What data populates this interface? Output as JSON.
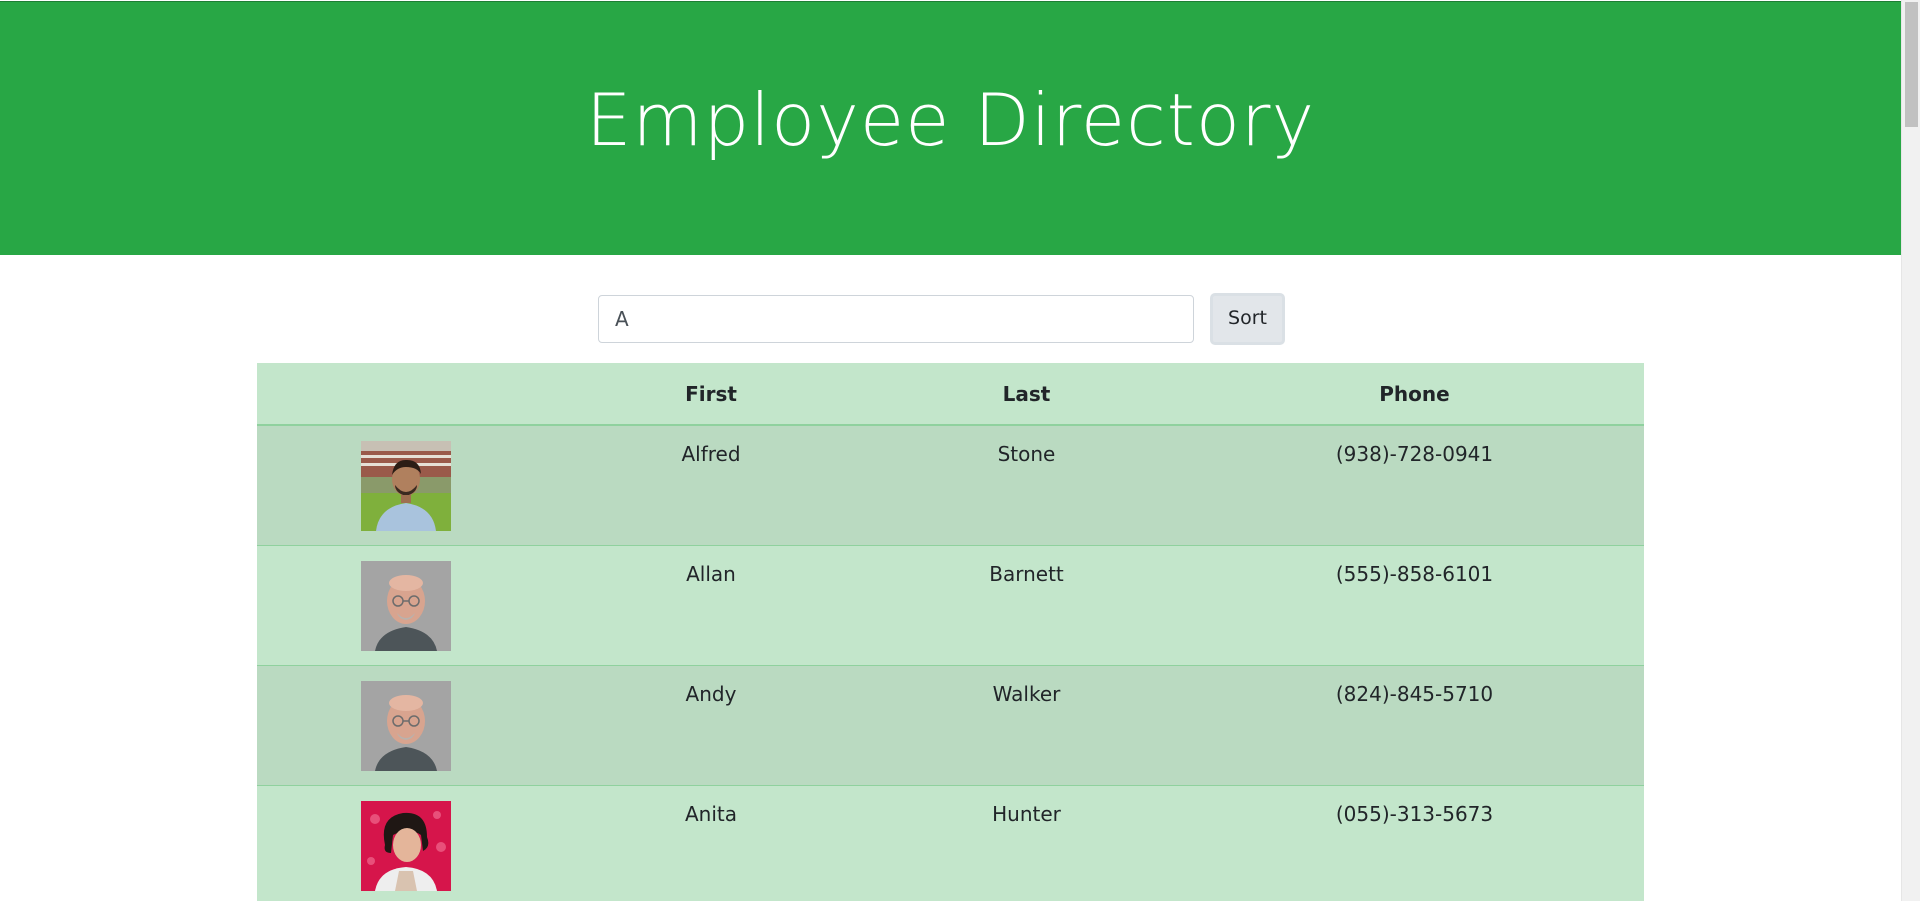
{
  "header": {
    "title": "Employee Directory"
  },
  "search": {
    "value": "A",
    "button_label": "Sort"
  },
  "table": {
    "columns": [
      "",
      "First",
      "Last",
      "Phone"
    ],
    "rows": [
      {
        "first": "Alfred",
        "last": "Stone",
        "phone": "(938)-728-0941",
        "avatar": "man-dark-hair-outdoor-photo"
      },
      {
        "first": "Allan",
        "last": "Barnett",
        "phone": "(555)-858-6101",
        "avatar": "bald-man-glasses-photo"
      },
      {
        "first": "Andy",
        "last": "Walker",
        "phone": "(824)-845-5710",
        "avatar": "bald-man-glasses-photo"
      },
      {
        "first": "Anita",
        "last": "Hunter",
        "phone": "(055)-313-5673",
        "avatar": "woman-curly-hair-red-background-photo"
      }
    ]
  },
  "colors": {
    "header_bg": "#28a745",
    "table_header_bg": "#c3e6cb",
    "row_odd_bg": "#badac1",
    "row_even_bg": "#c3e6cb"
  }
}
